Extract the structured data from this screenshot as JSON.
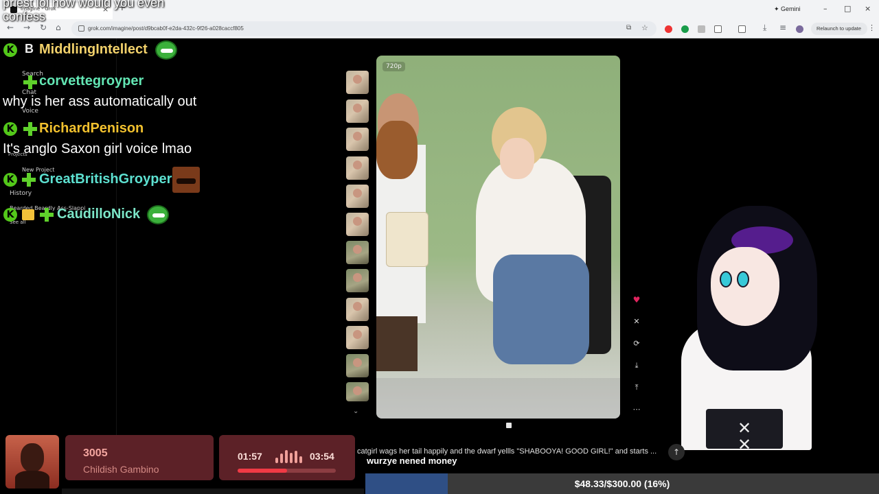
{
  "browser": {
    "tab_title": "Imagine - Grok",
    "tab_close": "×",
    "new_tab": "+",
    "url": "grok.com/imagine/post/d9bcab0f-e2da-432c-9f26-a028caccf805",
    "gemini_label": "Gemini",
    "relaunch_label": "Relaunch to update",
    "minimize": "–",
    "maximize": "□",
    "close": "×"
  },
  "sidebar_ghost": {
    "search": "Search",
    "chat": "Chat",
    "voice": "Voice",
    "projects": "Projects",
    "new_project": "New Project",
    "history": "History",
    "history_item": "Bearded Beardly Ass-Slappi",
    "see_all": "See all"
  },
  "chat": {
    "overlay_top": "priest lol how would you even confess",
    "messages": [
      {
        "badge": "K",
        "extra": "B",
        "name": "MiddlingIntellect",
        "name_color": "#f2d16b",
        "text": ""
      },
      {
        "badge": "",
        "extra": "",
        "name": "corvettegroyper",
        "name_color": "#63e6b4",
        "text": "why is her ass automatically out"
      },
      {
        "badge": "K",
        "extra": "",
        "name": "RichardPenison",
        "name_color": "#f2c12e",
        "text": "It's anglo Saxon girl voice lmao"
      },
      {
        "badge": "K",
        "extra": "",
        "name": "GreatBritishGroyper",
        "name_color": "#5de0d0",
        "text": ""
      },
      {
        "badge": "K",
        "extra": "",
        "name": "CaudilloNick",
        "name_color": "#7ce6c8",
        "text": ""
      }
    ]
  },
  "viewer": {
    "quality_label": "720p",
    "prompt_text": "catgirl wags her tail happily and the dwarf yellls \"SHABOOYA! GOOD GIRL!\" and starts ...",
    "caption": "wurzye nened money",
    "actions": [
      "heart-icon",
      "x-share-icon",
      "refresh-icon",
      "download-icon",
      "upload-icon",
      "more-icon"
    ],
    "thumbnail_count": 12
  },
  "now_playing": {
    "track": "3005",
    "artist": "Childish Gambino",
    "elapsed": "01:57",
    "duration": "03:54",
    "progress_fraction": 0.5
  },
  "goal": {
    "text": "$48.33/$300.00 (16%)",
    "fraction": 0.16
  },
  "colors": {
    "accent_red": "#f03a45",
    "card_bg": "#5c2127",
    "goal_fill": "#2f4f85"
  }
}
